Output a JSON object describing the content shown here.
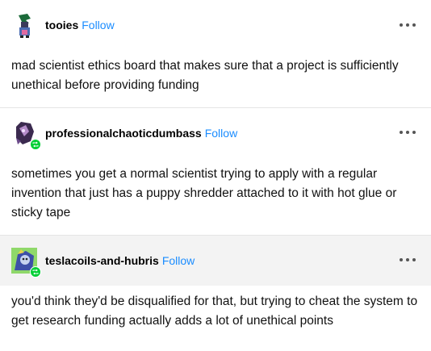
{
  "posts": [
    {
      "username": "tooies",
      "follow_label": "Follow",
      "has_reblog_badge": false,
      "text": "mad scientist ethics board that makes sure that a project is sufficiently unethical before providing funding"
    },
    {
      "username": "professionalchaoticdumbass",
      "follow_label": "Follow",
      "has_reblog_badge": true,
      "text": "sometimes you get a normal scientist trying to apply with a regular invention that just has a puppy shredder attached to it with hot glue or sticky tape"
    },
    {
      "username": "teslacoils-and-hubris",
      "follow_label": "Follow",
      "has_reblog_badge": true,
      "text": "you'd think they'd be disqualified for that, but trying to cheat the system to get research funding actually adds a lot of unethical points"
    }
  ],
  "icons": {
    "more": "more-options-icon",
    "badge": "reblog-badge-icon"
  },
  "colors": {
    "follow": "#1a8cff",
    "badge": "#00cf35",
    "shaded_header": "#f3f3f3"
  }
}
